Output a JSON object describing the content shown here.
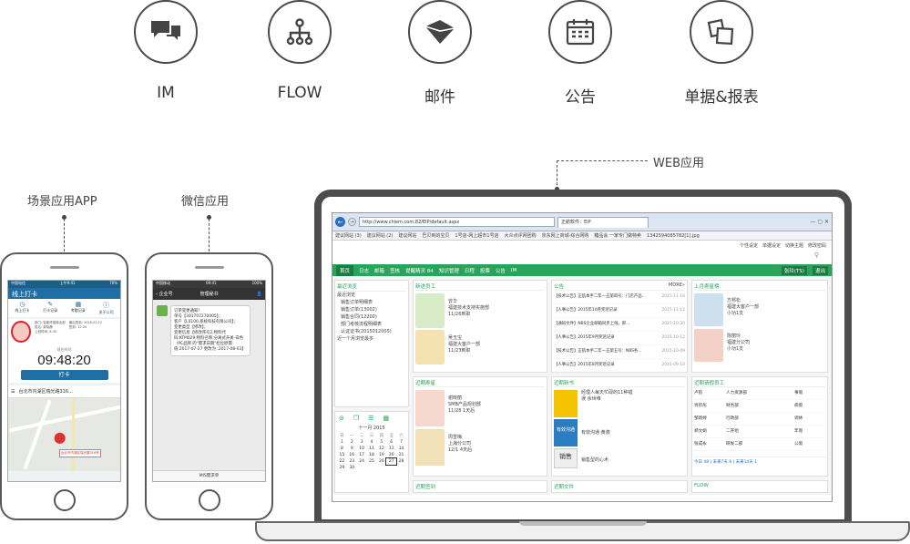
{
  "features": [
    {
      "label": "IM",
      "icon": "chat-bubbles-icon"
    },
    {
      "label": "FLOW",
      "icon": "flow-tree-icon"
    },
    {
      "label": "邮件",
      "icon": "mail-icon"
    },
    {
      "label": "公告",
      "icon": "calendar-icon"
    },
    {
      "label": "单据&报表",
      "icon": "documents-icon"
    }
  ],
  "callouts": {
    "app": "场景应用APP",
    "wechat": "微信应用",
    "web": "WEB应用"
  },
  "app": {
    "carrier": "中国电信",
    "time": "上午9:41",
    "battery": "70%",
    "title": "线上打卡",
    "tabs": [
      "线上打卡",
      "打卡记录",
      "考勤记录",
      "关于公司"
    ],
    "info": [
      "部门: 智能终端事业部",
      "姓名: 梁晓静",
      "最后签到: 2018.02.12",
      "签到: 12:00",
      "上班时间: 8:30"
    ],
    "clock_label": "现在时间",
    "clock": "09:48:20",
    "punch": "打卡",
    "address": "台北市内湖区瑞光路316...",
    "map_note": "台北市内湖区瑞光路316号"
  },
  "wechat": {
    "carrier": "中国移动",
    "time": "09:41",
    "battery": "100%",
    "back": "企业号",
    "title": "管理秘书",
    "message": "订单变更通知！\n单号【301707270005】；\n客户【L0100,系统科技有限公司】；\n变更类型【修改】；\n变更信息【修改序号2,物料代码:KTM029,物料名称:分离式开关-白色（PC品牌 的\"需求日期\"栏位原需值:2017-07-27 更改为 :2017-08-03】",
    "footer": "MIS需求单"
  },
  "browser": {
    "url": "http://www.chiem.com:82/EIP/default.aspx",
    "tab": "正航软件：EIP",
    "favorites": [
      "建议网站 (3)",
      "建议网站 (2)",
      "建议网站",
      "巴贝到的宝贝",
      "1号店-网上超市1号店",
      "大众点评网团购",
      "京东网上商城-综合网购",
      "糖品会 一家专门做特卖",
      "1342594085782[1].jpg"
    ],
    "top_links": [
      "个性设定",
      "单据设定",
      "切换主题",
      "修改密码"
    ],
    "nav": [
      "首页",
      "日志",
      "邮箱",
      "签核",
      "提醒精灵 84",
      "知识管理",
      "日程",
      "投票",
      "公告",
      "IM"
    ],
    "nav_right": [
      "张玲(TS)",
      "退出"
    ],
    "recent": {
      "title": "最近浏览",
      "items": [
        "最近浏览",
        "销售订单明细表",
        "销售订单(13002)",
        "销售合同(12200)",
        "部门考核流程明细表",
        "认证证书(2015012005)",
        "近一个月浏览最多"
      ]
    },
    "calendar": {
      "header": "十一月 2015",
      "days": [
        "日",
        "一",
        "二",
        "三",
        "四",
        "五",
        "六"
      ],
      "dates": [
        "1",
        "2",
        "3",
        "4",
        "5",
        "6",
        "7",
        "8",
        "9",
        "10",
        "11",
        "12",
        "13",
        "14",
        "15",
        "16",
        "17",
        "18",
        "19",
        "20",
        "21",
        "22",
        "23",
        "24",
        "25",
        "26",
        "27",
        "28",
        "29",
        "30"
      ]
    },
    "new_staff": {
      "title": "新进员工",
      "people": [
        {
          "name": "曾华",
          "dept": "福建技术支持实施部",
          "date": "11/26到职"
        },
        {
          "name": "吴玉宝",
          "dept": "福建大客户一部",
          "date": "11/23到职"
        }
      ]
    },
    "notices": {
      "title": "公告",
      "more": "MORE»",
      "items": [
        {
          "text": "【技术公告】正航本手二年一五第四号：门店产品...",
          "date": "2015-11-16"
        },
        {
          "text": "【人事公告】2015年10月奖惩记录",
          "date": "2015-11-12"
        },
        {
          "text": "【通知文件】NBS企业邮箱同步上线，即...",
          "date": "2015-10-30"
        },
        {
          "text": "【人事公告】2015年9月奖惩记录",
          "date": "2015-10-12"
        },
        {
          "text": "【技术公告】正航本手二年一五第五号：NBS各...",
          "date": "2015-10-09"
        },
        {
          "text": "【人事公告】2015年8月奖惩记录",
          "date": "2015-09-10"
        }
      ]
    },
    "birthday": {
      "title": "上月寿星榜",
      "people": [
        {
          "name": "方邦松",
          "dept": "福建大客户一部",
          "note": "小功1支"
        },
        {
          "name": "陈丽玲",
          "dept": "福建分公司",
          "note": "小功1支"
        }
      ]
    },
    "stars": {
      "title": "近期寿星",
      "people": [
        {
          "name": "谢晓丽",
          "dept": "SMB产品规划部",
          "date": "11/28 1天后"
        },
        {
          "name": "周雪梅",
          "dept": "上海分公司",
          "date": "12/1 4天后"
        }
      ]
    },
    "books": {
      "title": "近期新书",
      "items": [
        "经理人每天忙碌的11种错误 余世维",
        "有效沟通 黄漪",
        "销售型的心术"
      ],
      "cover": "销售",
      "cover2": "有效沟通"
    },
    "leave": {
      "title": "近期请假员工",
      "rows": [
        [
          "卢航",
          "人力资源部",
          "事假"
        ],
        [
          "肖钦彤",
          "财务部",
          "病假"
        ],
        [
          "邹晓婷",
          "行政部",
          "调休"
        ],
        [
          "郑文娟",
          "二开组",
          "年假"
        ],
        [
          "张成永",
          "研发二部",
          "公假"
        ]
      ],
      "footer": "今日 48 | 未来7天 6 | 未来14天 1"
    },
    "bottom": [
      "近期签到",
      "近期文件",
      "FLOW"
    ]
  }
}
